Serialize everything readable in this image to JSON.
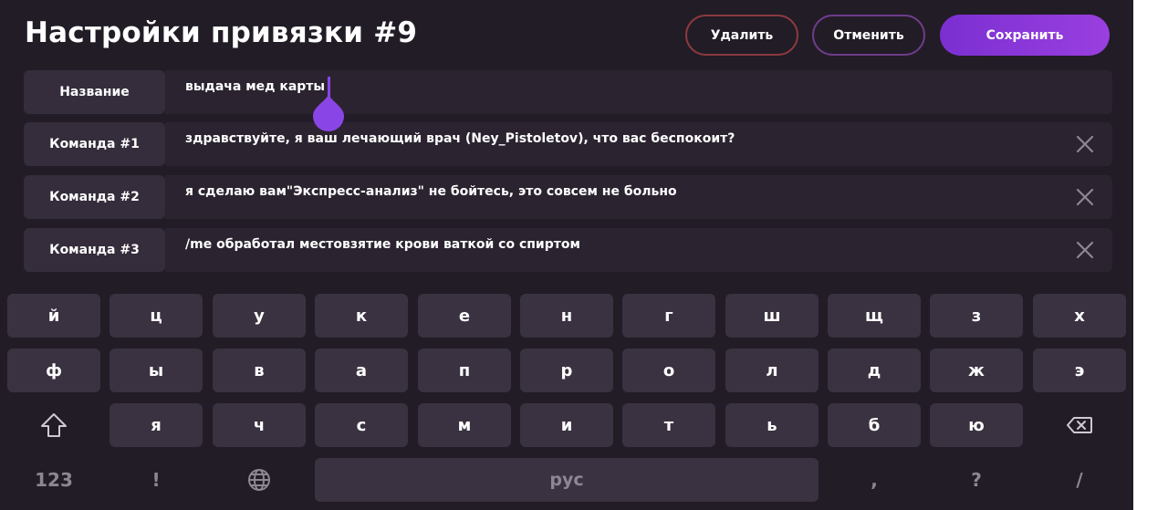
{
  "header": {
    "title": "Настройки привязки #9",
    "delete_label": "Удалить",
    "cancel_label": "Отменить",
    "save_label": "Сохранить"
  },
  "rows": [
    {
      "label": "Название",
      "value": "выдача мед карты"
    },
    {
      "label": "Команда #1",
      "value": "здравствуйте, я ваш лечающий врач (Ney_Pistoletov), что вас беспокоит?"
    },
    {
      "label": "Команда #2",
      "value": "я сделаю вам\"Экспресс-анализ\" не бойтесь, это совсем не больно"
    },
    {
      "label": "Команда #3",
      "value": "/me обработал местовзятие крови ваткой со спиртом"
    }
  ],
  "keyboard": {
    "row1": [
      "й",
      "ц",
      "у",
      "к",
      "е",
      "н",
      "г",
      "ш",
      "щ",
      "з",
      "х"
    ],
    "row2": [
      "ф",
      "ы",
      "в",
      "а",
      "п",
      "р",
      "о",
      "л",
      "д",
      "ж",
      "э"
    ],
    "row3": [
      "я",
      "ч",
      "с",
      "м",
      "и",
      "т",
      "ь",
      "б",
      "ю"
    ],
    "numbers_key": "123",
    "exclamation_key": "!",
    "space_label": "рус",
    "comma_key": ",",
    "question_key": "?",
    "slash_key": "/"
  },
  "colors": {
    "background": "#221c26",
    "accent": "#8a45e6",
    "delete_border": "#8a3a3f",
    "cancel_border": "#6d3c8a",
    "key_background": "#3a3240"
  },
  "icons": {
    "clear": "close-icon",
    "shift": "shift-icon",
    "backspace": "backspace-icon",
    "language": "globe-icon",
    "text_cursor": "text-cursor-handle-icon"
  }
}
